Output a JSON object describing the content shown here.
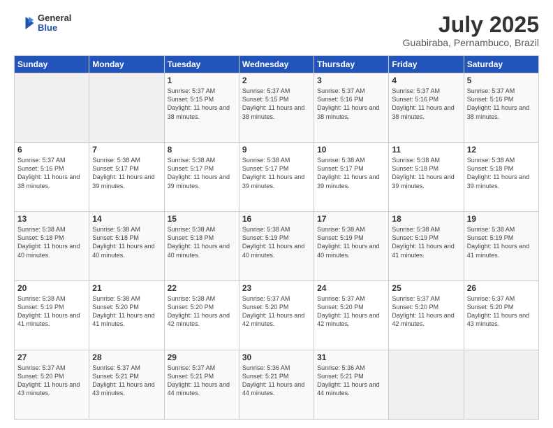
{
  "header": {
    "logo": {
      "general": "General",
      "blue": "Blue"
    },
    "title": "July 2025",
    "subtitle": "Guabiraba, Pernambuco, Brazil"
  },
  "calendar": {
    "days_of_week": [
      "Sunday",
      "Monday",
      "Tuesday",
      "Wednesday",
      "Thursday",
      "Friday",
      "Saturday"
    ],
    "weeks": [
      [
        {
          "day": "",
          "empty": true
        },
        {
          "day": "",
          "empty": true
        },
        {
          "day": "1",
          "sunrise": "5:37 AM",
          "sunset": "5:15 PM",
          "daylight": "11 hours and 38 minutes."
        },
        {
          "day": "2",
          "sunrise": "5:37 AM",
          "sunset": "5:15 PM",
          "daylight": "11 hours and 38 minutes."
        },
        {
          "day": "3",
          "sunrise": "5:37 AM",
          "sunset": "5:16 PM",
          "daylight": "11 hours and 38 minutes."
        },
        {
          "day": "4",
          "sunrise": "5:37 AM",
          "sunset": "5:16 PM",
          "daylight": "11 hours and 38 minutes."
        },
        {
          "day": "5",
          "sunrise": "5:37 AM",
          "sunset": "5:16 PM",
          "daylight": "11 hours and 38 minutes."
        }
      ],
      [
        {
          "day": "6",
          "sunrise": "5:37 AM",
          "sunset": "5:16 PM",
          "daylight": "11 hours and 38 minutes."
        },
        {
          "day": "7",
          "sunrise": "5:38 AM",
          "sunset": "5:17 PM",
          "daylight": "11 hours and 39 minutes."
        },
        {
          "day": "8",
          "sunrise": "5:38 AM",
          "sunset": "5:17 PM",
          "daylight": "11 hours and 39 minutes."
        },
        {
          "day": "9",
          "sunrise": "5:38 AM",
          "sunset": "5:17 PM",
          "daylight": "11 hours and 39 minutes."
        },
        {
          "day": "10",
          "sunrise": "5:38 AM",
          "sunset": "5:17 PM",
          "daylight": "11 hours and 39 minutes."
        },
        {
          "day": "11",
          "sunrise": "5:38 AM",
          "sunset": "5:18 PM",
          "daylight": "11 hours and 39 minutes."
        },
        {
          "day": "12",
          "sunrise": "5:38 AM",
          "sunset": "5:18 PM",
          "daylight": "11 hours and 39 minutes."
        }
      ],
      [
        {
          "day": "13",
          "sunrise": "5:38 AM",
          "sunset": "5:18 PM",
          "daylight": "11 hours and 40 minutes."
        },
        {
          "day": "14",
          "sunrise": "5:38 AM",
          "sunset": "5:18 PM",
          "daylight": "11 hours and 40 minutes."
        },
        {
          "day": "15",
          "sunrise": "5:38 AM",
          "sunset": "5:18 PM",
          "daylight": "11 hours and 40 minutes."
        },
        {
          "day": "16",
          "sunrise": "5:38 AM",
          "sunset": "5:19 PM",
          "daylight": "11 hours and 40 minutes."
        },
        {
          "day": "17",
          "sunrise": "5:38 AM",
          "sunset": "5:19 PM",
          "daylight": "11 hours and 40 minutes."
        },
        {
          "day": "18",
          "sunrise": "5:38 AM",
          "sunset": "5:19 PM",
          "daylight": "11 hours and 41 minutes."
        },
        {
          "day": "19",
          "sunrise": "5:38 AM",
          "sunset": "5:19 PM",
          "daylight": "11 hours and 41 minutes."
        }
      ],
      [
        {
          "day": "20",
          "sunrise": "5:38 AM",
          "sunset": "5:19 PM",
          "daylight": "11 hours and 41 minutes."
        },
        {
          "day": "21",
          "sunrise": "5:38 AM",
          "sunset": "5:20 PM",
          "daylight": "11 hours and 41 minutes."
        },
        {
          "day": "22",
          "sunrise": "5:38 AM",
          "sunset": "5:20 PM",
          "daylight": "11 hours and 42 minutes."
        },
        {
          "day": "23",
          "sunrise": "5:37 AM",
          "sunset": "5:20 PM",
          "daylight": "11 hours and 42 minutes."
        },
        {
          "day": "24",
          "sunrise": "5:37 AM",
          "sunset": "5:20 PM",
          "daylight": "11 hours and 42 minutes."
        },
        {
          "day": "25",
          "sunrise": "5:37 AM",
          "sunset": "5:20 PM",
          "daylight": "11 hours and 42 minutes."
        },
        {
          "day": "26",
          "sunrise": "5:37 AM",
          "sunset": "5:20 PM",
          "daylight": "11 hours and 43 minutes."
        }
      ],
      [
        {
          "day": "27",
          "sunrise": "5:37 AM",
          "sunset": "5:20 PM",
          "daylight": "11 hours and 43 minutes."
        },
        {
          "day": "28",
          "sunrise": "5:37 AM",
          "sunset": "5:21 PM",
          "daylight": "11 hours and 43 minutes."
        },
        {
          "day": "29",
          "sunrise": "5:37 AM",
          "sunset": "5:21 PM",
          "daylight": "11 hours and 44 minutes."
        },
        {
          "day": "30",
          "sunrise": "5:36 AM",
          "sunset": "5:21 PM",
          "daylight": "11 hours and 44 minutes."
        },
        {
          "day": "31",
          "sunrise": "5:36 AM",
          "sunset": "5:21 PM",
          "daylight": "11 hours and 44 minutes."
        },
        {
          "day": "",
          "empty": true
        },
        {
          "day": "",
          "empty": true
        }
      ]
    ]
  }
}
